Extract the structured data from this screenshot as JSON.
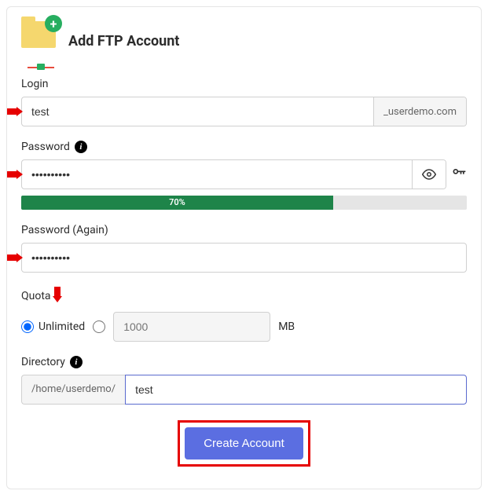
{
  "header": {
    "title": "Add FTP Account"
  },
  "login": {
    "label": "Login",
    "value": "test",
    "suffix": "_userdemo.com"
  },
  "password": {
    "label": "Password",
    "value": "••••••••••",
    "strength_pct": 70,
    "strength_text": "70%"
  },
  "password_again": {
    "label": "Password (Again)",
    "value": "••••••••••"
  },
  "quota": {
    "label": "Quota",
    "unlimited_label": "Unlimited",
    "custom_placeholder": "1000",
    "unit": "MB"
  },
  "directory": {
    "label": "Directory",
    "prefix": "/home/userdemo/",
    "value": "test"
  },
  "submit": {
    "label": "Create Account"
  }
}
